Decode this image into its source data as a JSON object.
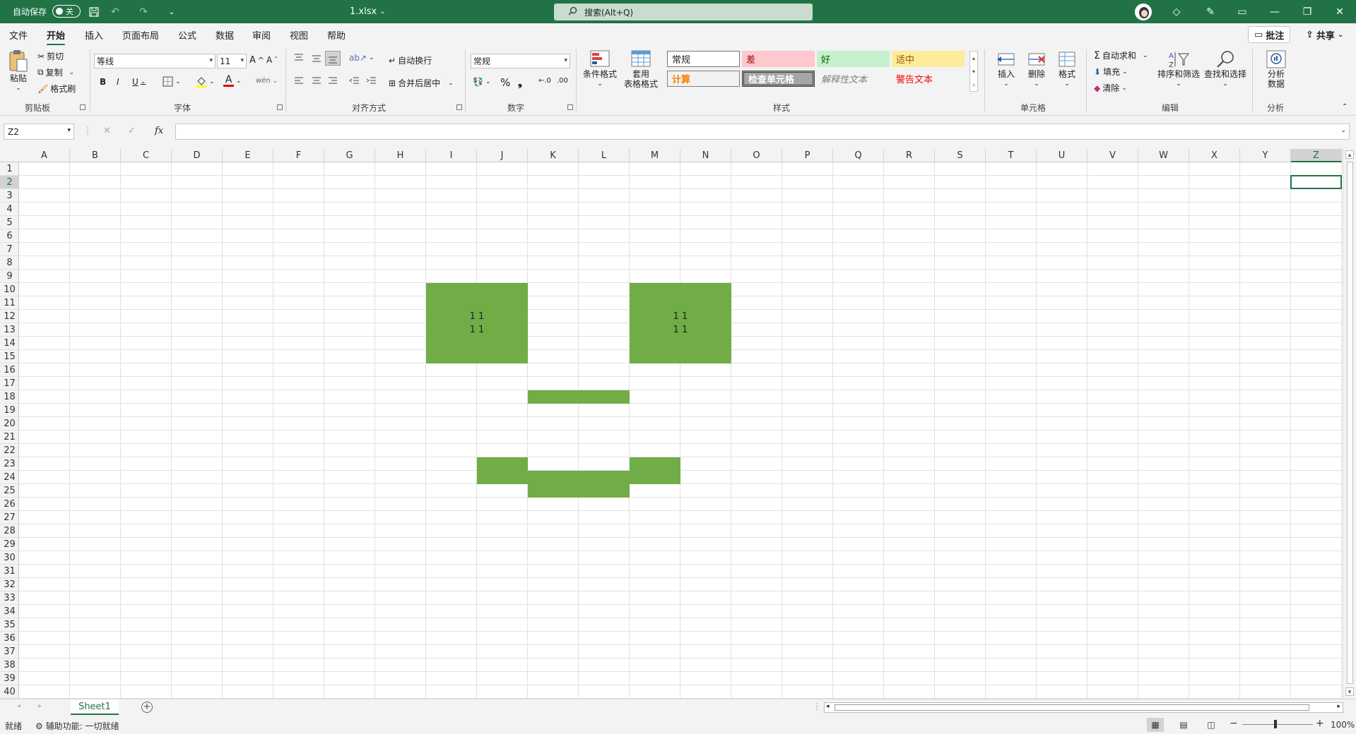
{
  "titlebar": {
    "autosave_label": "自动保存",
    "autosave_state": "关",
    "doc_title": "1.xlsx",
    "search_placeholder": "搜索(Alt+Q)"
  },
  "menu": {
    "tabs": [
      "文件",
      "开始",
      "插入",
      "页面布局",
      "公式",
      "数据",
      "审阅",
      "视图",
      "帮助"
    ],
    "active": "开始",
    "comments_label": "批注",
    "share_label": "共享"
  },
  "ribbon": {
    "clipboard": {
      "paste": "粘贴",
      "cut": "剪切",
      "copy": "复制",
      "format_painter": "格式刷",
      "group": "剪贴板"
    },
    "font": {
      "name": "等线",
      "size": "11",
      "group": "字体"
    },
    "alignment": {
      "wrap": "自动换行",
      "merge": "合并后居中",
      "group": "对齐方式"
    },
    "number": {
      "format": "常规",
      "group": "数字"
    },
    "styles": {
      "conditional": "条件格式",
      "table_line1": "套用",
      "table_line2": "表格格式",
      "cells": [
        {
          "label": "常规"
        },
        {
          "label": "差"
        },
        {
          "label": "好"
        },
        {
          "label": "适中"
        },
        {
          "label": "计算"
        },
        {
          "label": "检查单元格"
        },
        {
          "label": "解释性文本"
        },
        {
          "label": "警告文本"
        }
      ],
      "group": "样式"
    },
    "cells": {
      "insert": "插入",
      "delete": "删除",
      "format": "格式",
      "group": "单元格"
    },
    "editing": {
      "autosum": "自动求和",
      "fill": "填充",
      "clear": "清除",
      "sort": "排序和筛选",
      "find": "查找和选择",
      "group": "编辑"
    },
    "analysis": {
      "line1": "分析",
      "line2": "数据",
      "group": "分析"
    }
  },
  "formula_bar": {
    "name_box": "Z2",
    "fx": "fx",
    "value": ""
  },
  "grid": {
    "columns": [
      "A",
      "B",
      "C",
      "D",
      "E",
      "F",
      "G",
      "H",
      "I",
      "J",
      "K",
      "L",
      "M",
      "N",
      "O",
      "P",
      "Q",
      "R",
      "S",
      "T",
      "U",
      "V",
      "W",
      "X",
      "Y",
      "Z"
    ],
    "rows": [
      "1",
      "2",
      "3",
      "4",
      "5",
      "6",
      "7",
      "8",
      "9",
      "10",
      "11",
      "12",
      "13",
      "14",
      "15",
      "16",
      "17",
      "18",
      "19",
      "20",
      "21",
      "22",
      "23",
      "24",
      "25",
      "26",
      "27",
      "28",
      "29",
      "30",
      "31",
      "32",
      "33",
      "34",
      "35",
      "36",
      "37",
      "38",
      "39",
      "40"
    ],
    "selected_column": "Z",
    "selected_row": "2",
    "fill_color": "#70ad47",
    "cell_text": [
      "1 1",
      "1 1"
    ]
  },
  "sheets": {
    "tab": "Sheet1"
  },
  "status": {
    "ready": "就绪",
    "accessibility": "辅助功能: 一切就绪",
    "zoom": "100%"
  }
}
